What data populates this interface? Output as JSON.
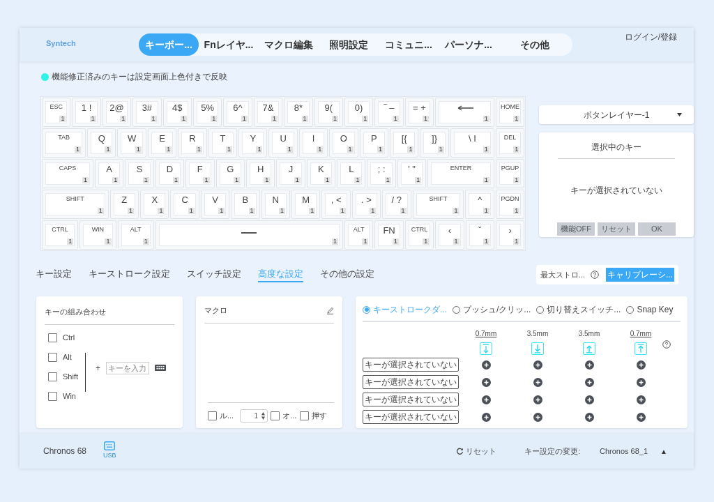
{
  "header": {
    "logo": "Syntech",
    "nav": [
      {
        "label": "キーボー...",
        "selected": true
      },
      {
        "label": "Fnレイヤ...",
        "selected": false
      },
      {
        "label": "マクロ編集",
        "selected": false
      },
      {
        "label": "照明設定",
        "selected": false
      },
      {
        "label": "コミュニ...",
        "selected": false
      },
      {
        "label": "パーソナ...",
        "selected": false
      },
      {
        "label": "その他",
        "selected": false
      }
    ],
    "login": "ログイン/登録"
  },
  "legend": {
    "color": "#2ff3e8",
    "text": "機能修正済みのキーは設定画面上色付きで反映"
  },
  "keyboard": {
    "rows": [
      {
        "keys": [
          {
            "label": "ESC",
            "layer": "1"
          },
          {
            "label": "1 !",
            "layer": "1"
          },
          {
            "label": "2@",
            "layer": "1"
          },
          {
            "label": "3#",
            "layer": "1"
          },
          {
            "label": "4$",
            "layer": "1"
          },
          {
            "label": "5%",
            "layer": "1"
          },
          {
            "label": "6^",
            "layer": "1"
          },
          {
            "label": "7&",
            "layer": "1"
          },
          {
            "label": "8*",
            "layer": "1"
          },
          {
            "label": "9(",
            "layer": "1"
          },
          {
            "label": "0)",
            "layer": "1"
          },
          {
            "label": "‾ –",
            "layer": "1"
          },
          {
            "label": "= +",
            "layer": "1"
          },
          {
            "kind": "backspace",
            "layer": "1"
          },
          {
            "label": "HOME",
            "layer": "1"
          }
        ]
      },
      {
        "keys": [
          {
            "label": "TAB",
            "layer": "1"
          },
          {
            "label": "Q",
            "layer": "1"
          },
          {
            "label": "W",
            "layer": "1"
          },
          {
            "label": "E",
            "layer": "1"
          },
          {
            "label": "R",
            "layer": "1"
          },
          {
            "label": "T",
            "layer": "1"
          },
          {
            "label": "Y",
            "layer": "1"
          },
          {
            "label": "U",
            "layer": "1"
          },
          {
            "label": "I",
            "layer": "1"
          },
          {
            "label": "O",
            "layer": "1"
          },
          {
            "label": "P",
            "layer": "1"
          },
          {
            "label": "[{",
            "layer": "1"
          },
          {
            "label": "]}",
            "layer": "1"
          },
          {
            "label": "\\ I",
            "layer": "1"
          },
          {
            "label": "DEL",
            "layer": "1"
          }
        ]
      },
      {
        "keys": [
          {
            "label": "CAPS",
            "layer": "1"
          },
          {
            "label": "A",
            "layer": "1"
          },
          {
            "label": "S",
            "layer": "1"
          },
          {
            "label": "D",
            "layer": "1"
          },
          {
            "label": "F",
            "layer": "1"
          },
          {
            "label": "G",
            "layer": "1"
          },
          {
            "label": "H",
            "layer": "1"
          },
          {
            "label": "J",
            "layer": "1"
          },
          {
            "label": "K",
            "layer": "1"
          },
          {
            "label": "L",
            "layer": "1"
          },
          {
            "label": "; :",
            "layer": "1"
          },
          {
            "label": "' \"",
            "layer": "1"
          },
          {
            "label": "ENTER",
            "layer": "1"
          },
          {
            "label": "PGUP",
            "layer": "1"
          }
        ]
      },
      {
        "keys": [
          {
            "label": "SHIFT",
            "layer": "1"
          },
          {
            "label": "Z",
            "layer": "1"
          },
          {
            "label": "X",
            "layer": "1"
          },
          {
            "label": "C",
            "layer": "1"
          },
          {
            "label": "V",
            "layer": "1"
          },
          {
            "label": "B",
            "layer": "1"
          },
          {
            "label": "N",
            "layer": "1"
          },
          {
            "label": "M",
            "layer": "1"
          },
          {
            "label": ", <",
            "layer": "1"
          },
          {
            "label": ". >",
            "layer": "1"
          },
          {
            "label": "/ ?",
            "layer": "1"
          },
          {
            "label": "SHIFT",
            "layer": "1"
          },
          {
            "label": "^",
            "layer": "1"
          },
          {
            "label": "PGDN",
            "layer": "1"
          }
        ]
      },
      {
        "keys": [
          {
            "label": "CTRL",
            "layer": "1"
          },
          {
            "label": "WIN",
            "layer": "1"
          },
          {
            "label": "ALT",
            "layer": "1"
          },
          {
            "kind": "space",
            "layer": "1"
          },
          {
            "label": "ALT",
            "layer": "1"
          },
          {
            "label": "FN",
            "layer": "1"
          },
          {
            "label": "CTRL",
            "layer": "1"
          },
          {
            "label": "‹",
            "layer": "1"
          },
          {
            "label": "ˇ",
            "layer": "1"
          },
          {
            "label": "›",
            "layer": "1"
          }
        ]
      }
    ]
  },
  "layer_select": {
    "value": "ボタンレイヤー-1"
  },
  "selected_key": {
    "title": "選択中のキー",
    "message": "キーが選択されていない",
    "buttons": [
      {
        "label": "機能OFF",
        "disabled": true
      },
      {
        "label": "リセット",
        "disabled": true
      },
      {
        "label": "OK",
        "disabled": true
      }
    ]
  },
  "settings_tabs": [
    {
      "label": "キー設定",
      "selected": false
    },
    {
      "label": "キーストローク設定",
      "selected": false
    },
    {
      "label": "スイッチ設定",
      "selected": false
    },
    {
      "label": "高度な設定",
      "selected": true
    },
    {
      "label": "その他の設定",
      "selected": false
    }
  ],
  "calibration": {
    "label": "最大ストロ...",
    "button": "キャリブレーシ..."
  },
  "combo": {
    "title": "キーの組み合わせ",
    "modifiers": [
      {
        "label": "Ctrl",
        "checked": false
      },
      {
        "label": "Alt",
        "checked": false
      },
      {
        "label": "Shift",
        "checked": false
      },
      {
        "label": "Win",
        "checked": false
      }
    ],
    "plus": "+",
    "placeholder": "キーを入力"
  },
  "macro": {
    "title": "マクロ",
    "options": [
      {
        "label": "ル...",
        "checked": false
      },
      {
        "label": "オ...",
        "checked": false
      },
      {
        "label": "押す",
        "checked": false
      }
    ],
    "count": "1"
  },
  "stroke": {
    "modes": [
      {
        "label": "キーストロークダ...",
        "selected": true
      },
      {
        "label": "プッシュ/クリッ...",
        "selected": false
      },
      {
        "label": "切り替えスイッチ...",
        "selected": false
      },
      {
        "label": "Snap Key",
        "selected": false
      }
    ],
    "columns": [
      {
        "distance": "0.7mm",
        "editable": true,
        "kind": "press-top"
      },
      {
        "distance": "3.5mm",
        "editable": false,
        "kind": "press-bottom"
      },
      {
        "distance": "3.5mm",
        "editable": false,
        "kind": "release-bottom"
      },
      {
        "distance": "0.7mm",
        "editable": true,
        "kind": "release-top"
      }
    ],
    "rows": [
      "キーが選択されていない",
      "キーが選択されていない",
      "キーが選択されていない",
      "キーが選択されていない"
    ]
  },
  "footer": {
    "device": "Chronos 68",
    "connection": "USB",
    "reset": "リセット",
    "config_label": "キー設定の変更:",
    "config": "Chronos 68_1",
    "toggle": "▲"
  }
}
